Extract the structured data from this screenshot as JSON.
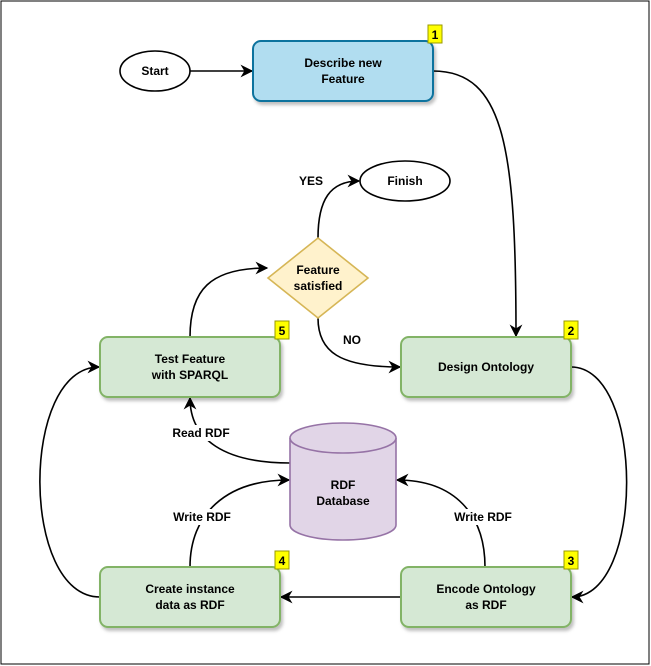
{
  "colors": {
    "blue_fill": "#b1ddf0",
    "blue_stroke": "#10739e",
    "green_fill": "#d5e8d4",
    "green_stroke": "#82b366",
    "yellow_fill": "#fff2cc",
    "yellow_stroke": "#d6b656",
    "purple_fill": "#e1d5e7",
    "purple_stroke": "#9673a6",
    "badge_fill": "#ffff00"
  },
  "nodes": {
    "start": "Start",
    "describe": {
      "line1": "Describe new",
      "line2": "Feature",
      "badge": "1"
    },
    "finish": "Finish",
    "decision": {
      "line1": "Feature",
      "line2": "satisfied"
    },
    "design": {
      "label": "Design Ontology",
      "badge": "2"
    },
    "test": {
      "line1": "Test Feature",
      "line2": "with SPARQL",
      "badge": "5"
    },
    "database": {
      "line1": "RDF",
      "line2": "Database"
    },
    "create": {
      "line1": "Create instance",
      "line2": "data as RDF",
      "badge": "4"
    },
    "encode": {
      "line1": "Encode Ontology",
      "line2": "as RDF",
      "badge": "3"
    }
  },
  "edges": {
    "yes": "YES",
    "no": "NO",
    "read_rdf": "Read RDF",
    "write_rdf_left": "Write RDF",
    "write_rdf_right": "Write RDF"
  }
}
